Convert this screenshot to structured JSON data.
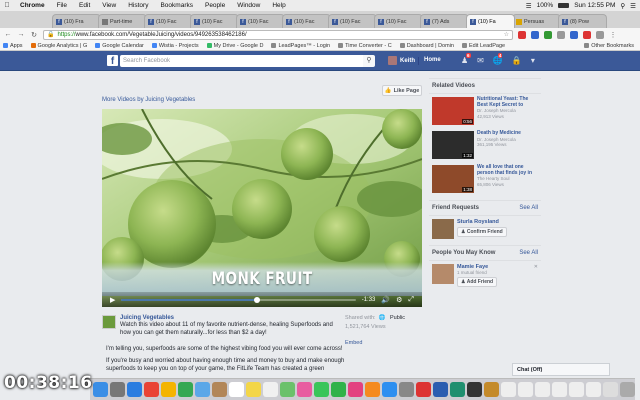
{
  "menubar": {
    "app": "Chrome",
    "items": [
      "File",
      "Edit",
      "View",
      "History",
      "Bookmarks",
      "People",
      "Window",
      "Help"
    ],
    "battery": "100%",
    "clock": "Sun 12:55 PM"
  },
  "tabs": [
    {
      "label": "(10) Fra",
      "icon": "facebook-icon"
    },
    {
      "label": "Part-time",
      "icon": "page-icon"
    },
    {
      "label": "(10) Fac",
      "icon": "facebook-icon"
    },
    {
      "label": "(10) Fac",
      "icon": "facebook-icon"
    },
    {
      "label": "(10) Fac",
      "icon": "facebook-icon"
    },
    {
      "label": "(10) Fac",
      "icon": "facebook-icon"
    },
    {
      "label": "(10) Fac",
      "icon": "facebook-icon"
    },
    {
      "label": "(10) Fac",
      "icon": "facebook-icon"
    },
    {
      "label": "(7) Ads",
      "icon": "facebook-icon"
    },
    {
      "label": "(10) Fa",
      "icon": "facebook-icon"
    },
    {
      "label": "Persuas",
      "icon": "page-icon"
    },
    {
      "label": "(8) Pow",
      "icon": "facebook-icon"
    }
  ],
  "address": {
    "scheme": "https://",
    "host": "www.facebook.com",
    "path": "/VegetableJuicing/videos/949263538462186/"
  },
  "bookmarks": [
    {
      "label": "Apps"
    },
    {
      "label": "Google Analytics | G"
    },
    {
      "label": "Google Calendar"
    },
    {
      "label": "Wistia - Projects"
    },
    {
      "label": "My Drive - Google D"
    },
    {
      "label": "LeadPages™ - Login"
    },
    {
      "label": "Time Converter - C"
    },
    {
      "label": "Dashboard | Domin"
    },
    {
      "label": "Edit LeadPage"
    }
  ],
  "bookmarks_other": "Other Bookmarks",
  "fb": {
    "search_placeholder": "Search Facebook",
    "user_name": "Keith",
    "home": "Home",
    "friend_badge": "6",
    "notif_badge": "4"
  },
  "page": {
    "more_videos": "More Videos by Juicing Vegetables",
    "like_page": "Like Page",
    "video_caption": "MONK FRUIT",
    "time_remaining": "-1:33",
    "progress_fraction": 0.58,
    "page_name": "Juicing Vegetables",
    "description": "Watch this video about 11 of my favorite nutrient-dense, healing Superfoods and how you can get them naturally...for less than $2 a day!",
    "para1": "I'm telling you, superfoods are some of the highest vibing food you will ever come across!",
    "para2": "If you're busy and worried about having enough time and money to buy and make enough superfoods to keep you on top of your game, the FitLife Team has created a green",
    "shared_with": "Shared with:",
    "shared_public": "Public",
    "views": "1,521,764 Views",
    "embed": "Embed"
  },
  "right": {
    "related_title": "Related Videos",
    "related": [
      {
        "title": "Nutritional Yeast: The Best Kept Secret to",
        "author": "Dr. Joseph Mercola",
        "views": "42,913 Views",
        "duration": "0:56",
        "color": "#c0392b"
      },
      {
        "title": "Death by Medicine",
        "author": "Dr. Joseph Mercola",
        "views": "361,195 Views",
        "duration": "1:32",
        "color": "#2c2c2c"
      },
      {
        "title": "We all love that one person that finds joy in",
        "author": "The Hearty Soul",
        "views": "65,806 Views",
        "duration": "1:38",
        "color": "#8e4a2a"
      }
    ],
    "friend_requests_title": "Friend Requests",
    "see_all": "See All",
    "friend_request": {
      "name": "Sturla Roysland",
      "button": "Confirm Friend"
    },
    "pymk_title": "People You May Know",
    "pymk": {
      "name": "Mamie Faye",
      "mutual": "1 mutual friend",
      "button": "Add Friend"
    }
  },
  "chat": "Chat (Off)",
  "timer": "00:38:16"
}
